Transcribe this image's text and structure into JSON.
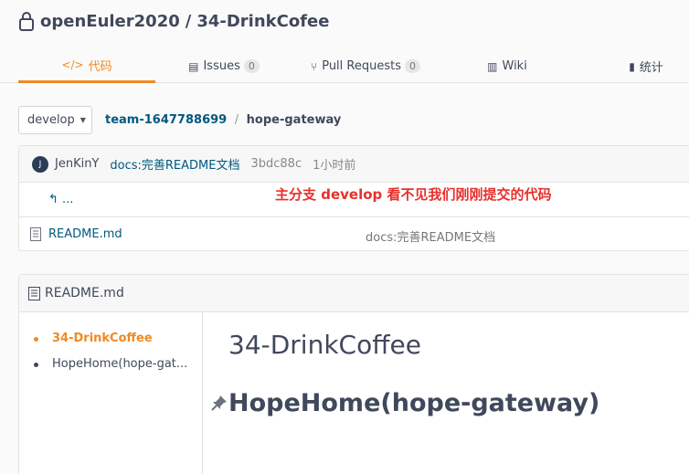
{
  "repo": {
    "owner": "openEuler2020",
    "separator": "/",
    "name": "34-DrinkCofee"
  },
  "tabs": [
    {
      "icon": "code-icon",
      "glyph": "</>",
      "label": "代码",
      "active": true
    },
    {
      "icon": "issues-icon",
      "glyph": "▤",
      "label": "Issues",
      "count": "0"
    },
    {
      "icon": "pull-request-icon",
      "glyph": "⑂",
      "label": "Pull Requests",
      "count": "0"
    },
    {
      "icon": "wiki-icon",
      "glyph": "▥",
      "label": "Wiki"
    },
    {
      "icon": "stats-icon",
      "glyph": "▮",
      "label": "统计"
    }
  ],
  "branch": {
    "label": "develop",
    "caret": "▼"
  },
  "breadcrumb": {
    "owner": "team-1647788699",
    "separator": "/",
    "repo": "hope-gateway"
  },
  "last_commit": {
    "avatar_initial": "J",
    "author": "JenKinY",
    "message": "docs:完善README文档",
    "sha": "3bdc88c",
    "time": "1小时前"
  },
  "parent_link": "↰ ...",
  "annotation": "主分支 develop 看不见我们刚刚提交的代码",
  "files": [
    {
      "name": "README.md",
      "commit": "docs:完善README文档"
    }
  ],
  "readme": {
    "title": "README.md",
    "toc": [
      {
        "label": "34-DrinkCoffee",
        "active": true
      },
      {
        "label": "HopeHome(hope-gat...",
        "active": false
      }
    ],
    "h1": "34-DrinkCoffee",
    "h2": "HopeHome(hope-gateway)"
  },
  "colors": {
    "accent": "#f08a24",
    "link": "#005980",
    "annotation": "#e8302c"
  }
}
